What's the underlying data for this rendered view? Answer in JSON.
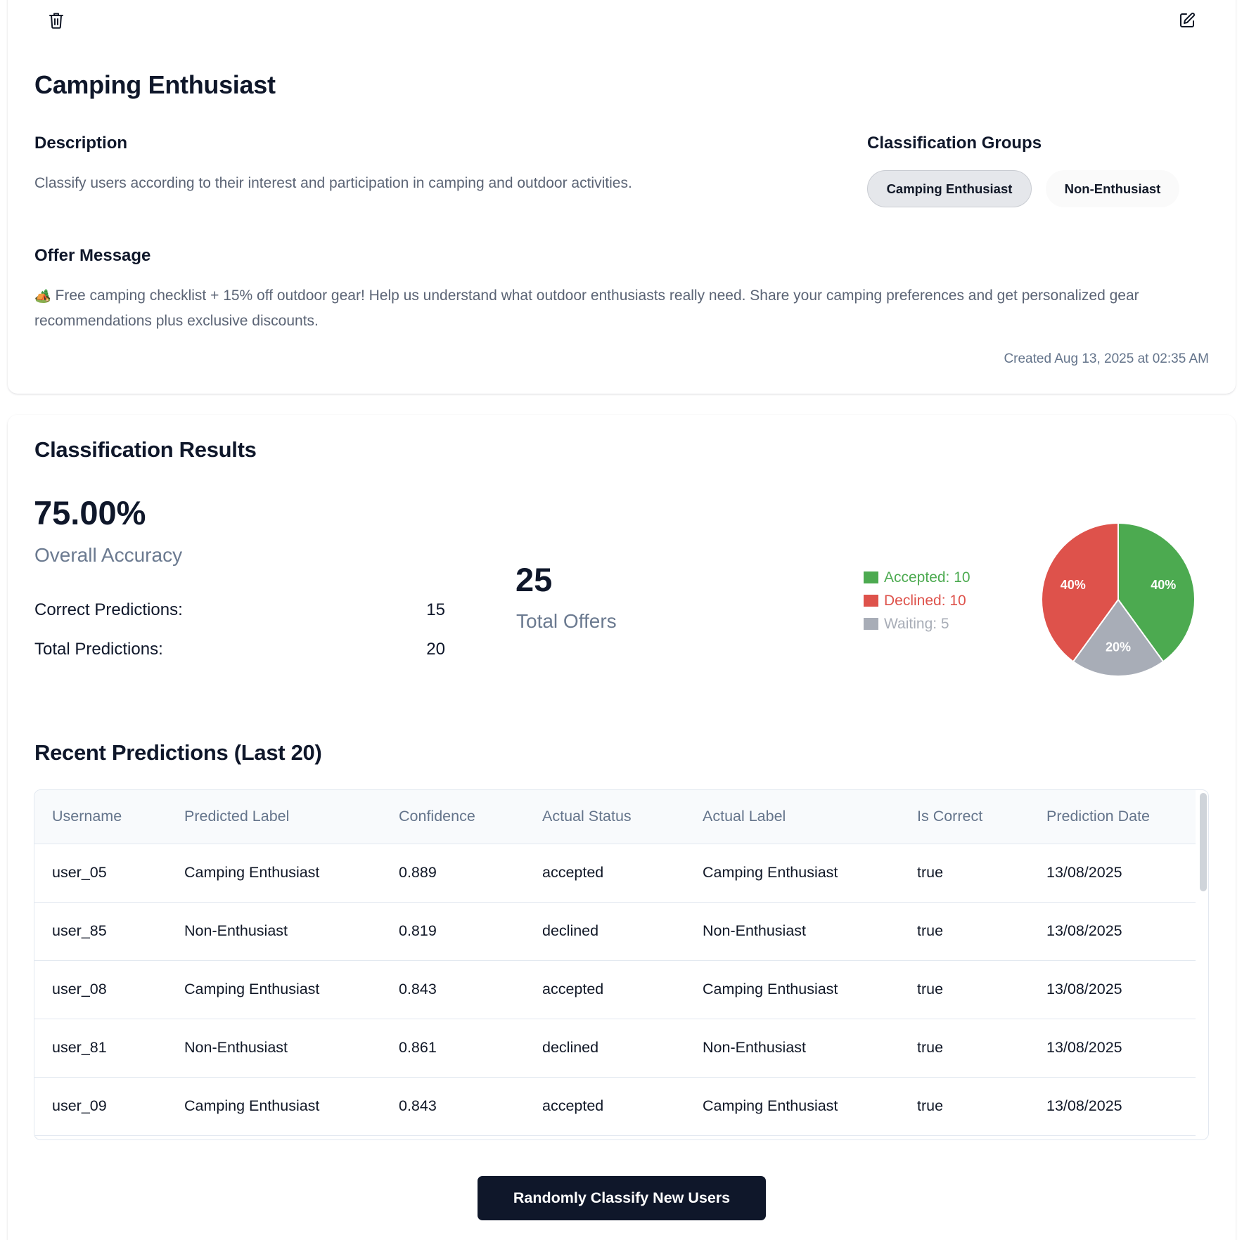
{
  "title": "Camping Enthusiast",
  "description": {
    "heading": "Description",
    "text": "Classify users according to their interest and participation in camping and outdoor activities."
  },
  "classification_groups": {
    "heading": "Classification Groups",
    "groups": [
      "Camping Enthusiast",
      "Non-Enthusiast"
    ],
    "selected": "Camping Enthusiast"
  },
  "offer_message": {
    "heading": "Offer Message",
    "emoji": "🏕️",
    "text": "Free camping checklist + 15% off outdoor gear! Help us understand what outdoor enthusiasts really need. Share your camping preferences and get personalized gear recommendations plus exclusive discounts."
  },
  "created": "Created Aug 13, 2025 at 02:35 AM",
  "icons": {
    "delete": "trash-icon",
    "edit": "edit-icon"
  },
  "results": {
    "heading": "Classification Results",
    "accuracy_value": "75.00%",
    "accuracy_label": "Overall Accuracy",
    "correct_label": "Correct Predictions:",
    "correct_value": "15",
    "total_label": "Total Predictions:",
    "total_value": "20",
    "offers_value": "25",
    "offers_label": "Total Offers"
  },
  "chart_data": {
    "type": "pie",
    "slices": [
      {
        "name": "Accepted",
        "value": 10,
        "color": "#4caa50",
        "label": "40%",
        "legend": "Accepted: 10"
      },
      {
        "name": "Waiting",
        "value": 5,
        "color": "#a8adb7",
        "label": "20%",
        "legend": "Waiting: 5"
      },
      {
        "name": "Declined",
        "value": 10,
        "color": "#de524b",
        "label": "40%",
        "legend": "Declined: 10"
      }
    ],
    "legend_order": [
      "Accepted",
      "Declined",
      "Waiting"
    ],
    "legend_placement": "left"
  },
  "predictions": {
    "heading": "Recent Predictions (Last 20)",
    "columns": [
      "Username",
      "Predicted Label",
      "Confidence",
      "Actual Status",
      "Actual Label",
      "Is Correct",
      "Prediction Date"
    ],
    "rows": [
      [
        "user_05",
        "Camping Enthusiast",
        "0.889",
        "accepted",
        "Camping Enthusiast",
        "true",
        "13/08/2025"
      ],
      [
        "user_85",
        "Non-Enthusiast",
        "0.819",
        "declined",
        "Non-Enthusiast",
        "true",
        "13/08/2025"
      ],
      [
        "user_08",
        "Camping Enthusiast",
        "0.843",
        "accepted",
        "Camping Enthusiast",
        "true",
        "13/08/2025"
      ],
      [
        "user_81",
        "Non-Enthusiast",
        "0.861",
        "declined",
        "Non-Enthusiast",
        "true",
        "13/08/2025"
      ],
      [
        "user_09",
        "Camping Enthusiast",
        "0.843",
        "accepted",
        "Camping Enthusiast",
        "true",
        "13/08/2025"
      ]
    ]
  },
  "action_button": "Randomly Classify New Users"
}
